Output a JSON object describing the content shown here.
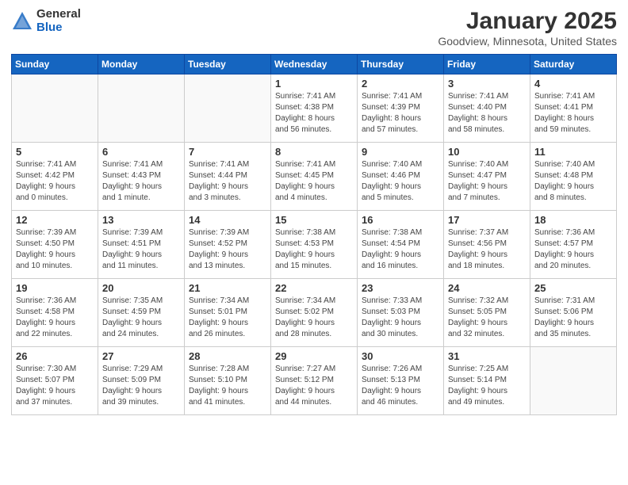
{
  "header": {
    "logo_general": "General",
    "logo_blue": "Blue",
    "month_title": "January 2025",
    "location": "Goodview, Minnesota, United States"
  },
  "weekdays": [
    "Sunday",
    "Monday",
    "Tuesday",
    "Wednesday",
    "Thursday",
    "Friday",
    "Saturday"
  ],
  "weeks": [
    [
      {
        "day": "",
        "info": ""
      },
      {
        "day": "",
        "info": ""
      },
      {
        "day": "",
        "info": ""
      },
      {
        "day": "1",
        "info": "Sunrise: 7:41 AM\nSunset: 4:38 PM\nDaylight: 8 hours\nand 56 minutes."
      },
      {
        "day": "2",
        "info": "Sunrise: 7:41 AM\nSunset: 4:39 PM\nDaylight: 8 hours\nand 57 minutes."
      },
      {
        "day": "3",
        "info": "Sunrise: 7:41 AM\nSunset: 4:40 PM\nDaylight: 8 hours\nand 58 minutes."
      },
      {
        "day": "4",
        "info": "Sunrise: 7:41 AM\nSunset: 4:41 PM\nDaylight: 8 hours\nand 59 minutes."
      }
    ],
    [
      {
        "day": "5",
        "info": "Sunrise: 7:41 AM\nSunset: 4:42 PM\nDaylight: 9 hours\nand 0 minutes."
      },
      {
        "day": "6",
        "info": "Sunrise: 7:41 AM\nSunset: 4:43 PM\nDaylight: 9 hours\nand 1 minute."
      },
      {
        "day": "7",
        "info": "Sunrise: 7:41 AM\nSunset: 4:44 PM\nDaylight: 9 hours\nand 3 minutes."
      },
      {
        "day": "8",
        "info": "Sunrise: 7:41 AM\nSunset: 4:45 PM\nDaylight: 9 hours\nand 4 minutes."
      },
      {
        "day": "9",
        "info": "Sunrise: 7:40 AM\nSunset: 4:46 PM\nDaylight: 9 hours\nand 5 minutes."
      },
      {
        "day": "10",
        "info": "Sunrise: 7:40 AM\nSunset: 4:47 PM\nDaylight: 9 hours\nand 7 minutes."
      },
      {
        "day": "11",
        "info": "Sunrise: 7:40 AM\nSunset: 4:48 PM\nDaylight: 9 hours\nand 8 minutes."
      }
    ],
    [
      {
        "day": "12",
        "info": "Sunrise: 7:39 AM\nSunset: 4:50 PM\nDaylight: 9 hours\nand 10 minutes."
      },
      {
        "day": "13",
        "info": "Sunrise: 7:39 AM\nSunset: 4:51 PM\nDaylight: 9 hours\nand 11 minutes."
      },
      {
        "day": "14",
        "info": "Sunrise: 7:39 AM\nSunset: 4:52 PM\nDaylight: 9 hours\nand 13 minutes."
      },
      {
        "day": "15",
        "info": "Sunrise: 7:38 AM\nSunset: 4:53 PM\nDaylight: 9 hours\nand 15 minutes."
      },
      {
        "day": "16",
        "info": "Sunrise: 7:38 AM\nSunset: 4:54 PM\nDaylight: 9 hours\nand 16 minutes."
      },
      {
        "day": "17",
        "info": "Sunrise: 7:37 AM\nSunset: 4:56 PM\nDaylight: 9 hours\nand 18 minutes."
      },
      {
        "day": "18",
        "info": "Sunrise: 7:36 AM\nSunset: 4:57 PM\nDaylight: 9 hours\nand 20 minutes."
      }
    ],
    [
      {
        "day": "19",
        "info": "Sunrise: 7:36 AM\nSunset: 4:58 PM\nDaylight: 9 hours\nand 22 minutes."
      },
      {
        "day": "20",
        "info": "Sunrise: 7:35 AM\nSunset: 4:59 PM\nDaylight: 9 hours\nand 24 minutes."
      },
      {
        "day": "21",
        "info": "Sunrise: 7:34 AM\nSunset: 5:01 PM\nDaylight: 9 hours\nand 26 minutes."
      },
      {
        "day": "22",
        "info": "Sunrise: 7:34 AM\nSunset: 5:02 PM\nDaylight: 9 hours\nand 28 minutes."
      },
      {
        "day": "23",
        "info": "Sunrise: 7:33 AM\nSunset: 5:03 PM\nDaylight: 9 hours\nand 30 minutes."
      },
      {
        "day": "24",
        "info": "Sunrise: 7:32 AM\nSunset: 5:05 PM\nDaylight: 9 hours\nand 32 minutes."
      },
      {
        "day": "25",
        "info": "Sunrise: 7:31 AM\nSunset: 5:06 PM\nDaylight: 9 hours\nand 35 minutes."
      }
    ],
    [
      {
        "day": "26",
        "info": "Sunrise: 7:30 AM\nSunset: 5:07 PM\nDaylight: 9 hours\nand 37 minutes."
      },
      {
        "day": "27",
        "info": "Sunrise: 7:29 AM\nSunset: 5:09 PM\nDaylight: 9 hours\nand 39 minutes."
      },
      {
        "day": "28",
        "info": "Sunrise: 7:28 AM\nSunset: 5:10 PM\nDaylight: 9 hours\nand 41 minutes."
      },
      {
        "day": "29",
        "info": "Sunrise: 7:27 AM\nSunset: 5:12 PM\nDaylight: 9 hours\nand 44 minutes."
      },
      {
        "day": "30",
        "info": "Sunrise: 7:26 AM\nSunset: 5:13 PM\nDaylight: 9 hours\nand 46 minutes."
      },
      {
        "day": "31",
        "info": "Sunrise: 7:25 AM\nSunset: 5:14 PM\nDaylight: 9 hours\nand 49 minutes."
      },
      {
        "day": "",
        "info": ""
      }
    ]
  ]
}
